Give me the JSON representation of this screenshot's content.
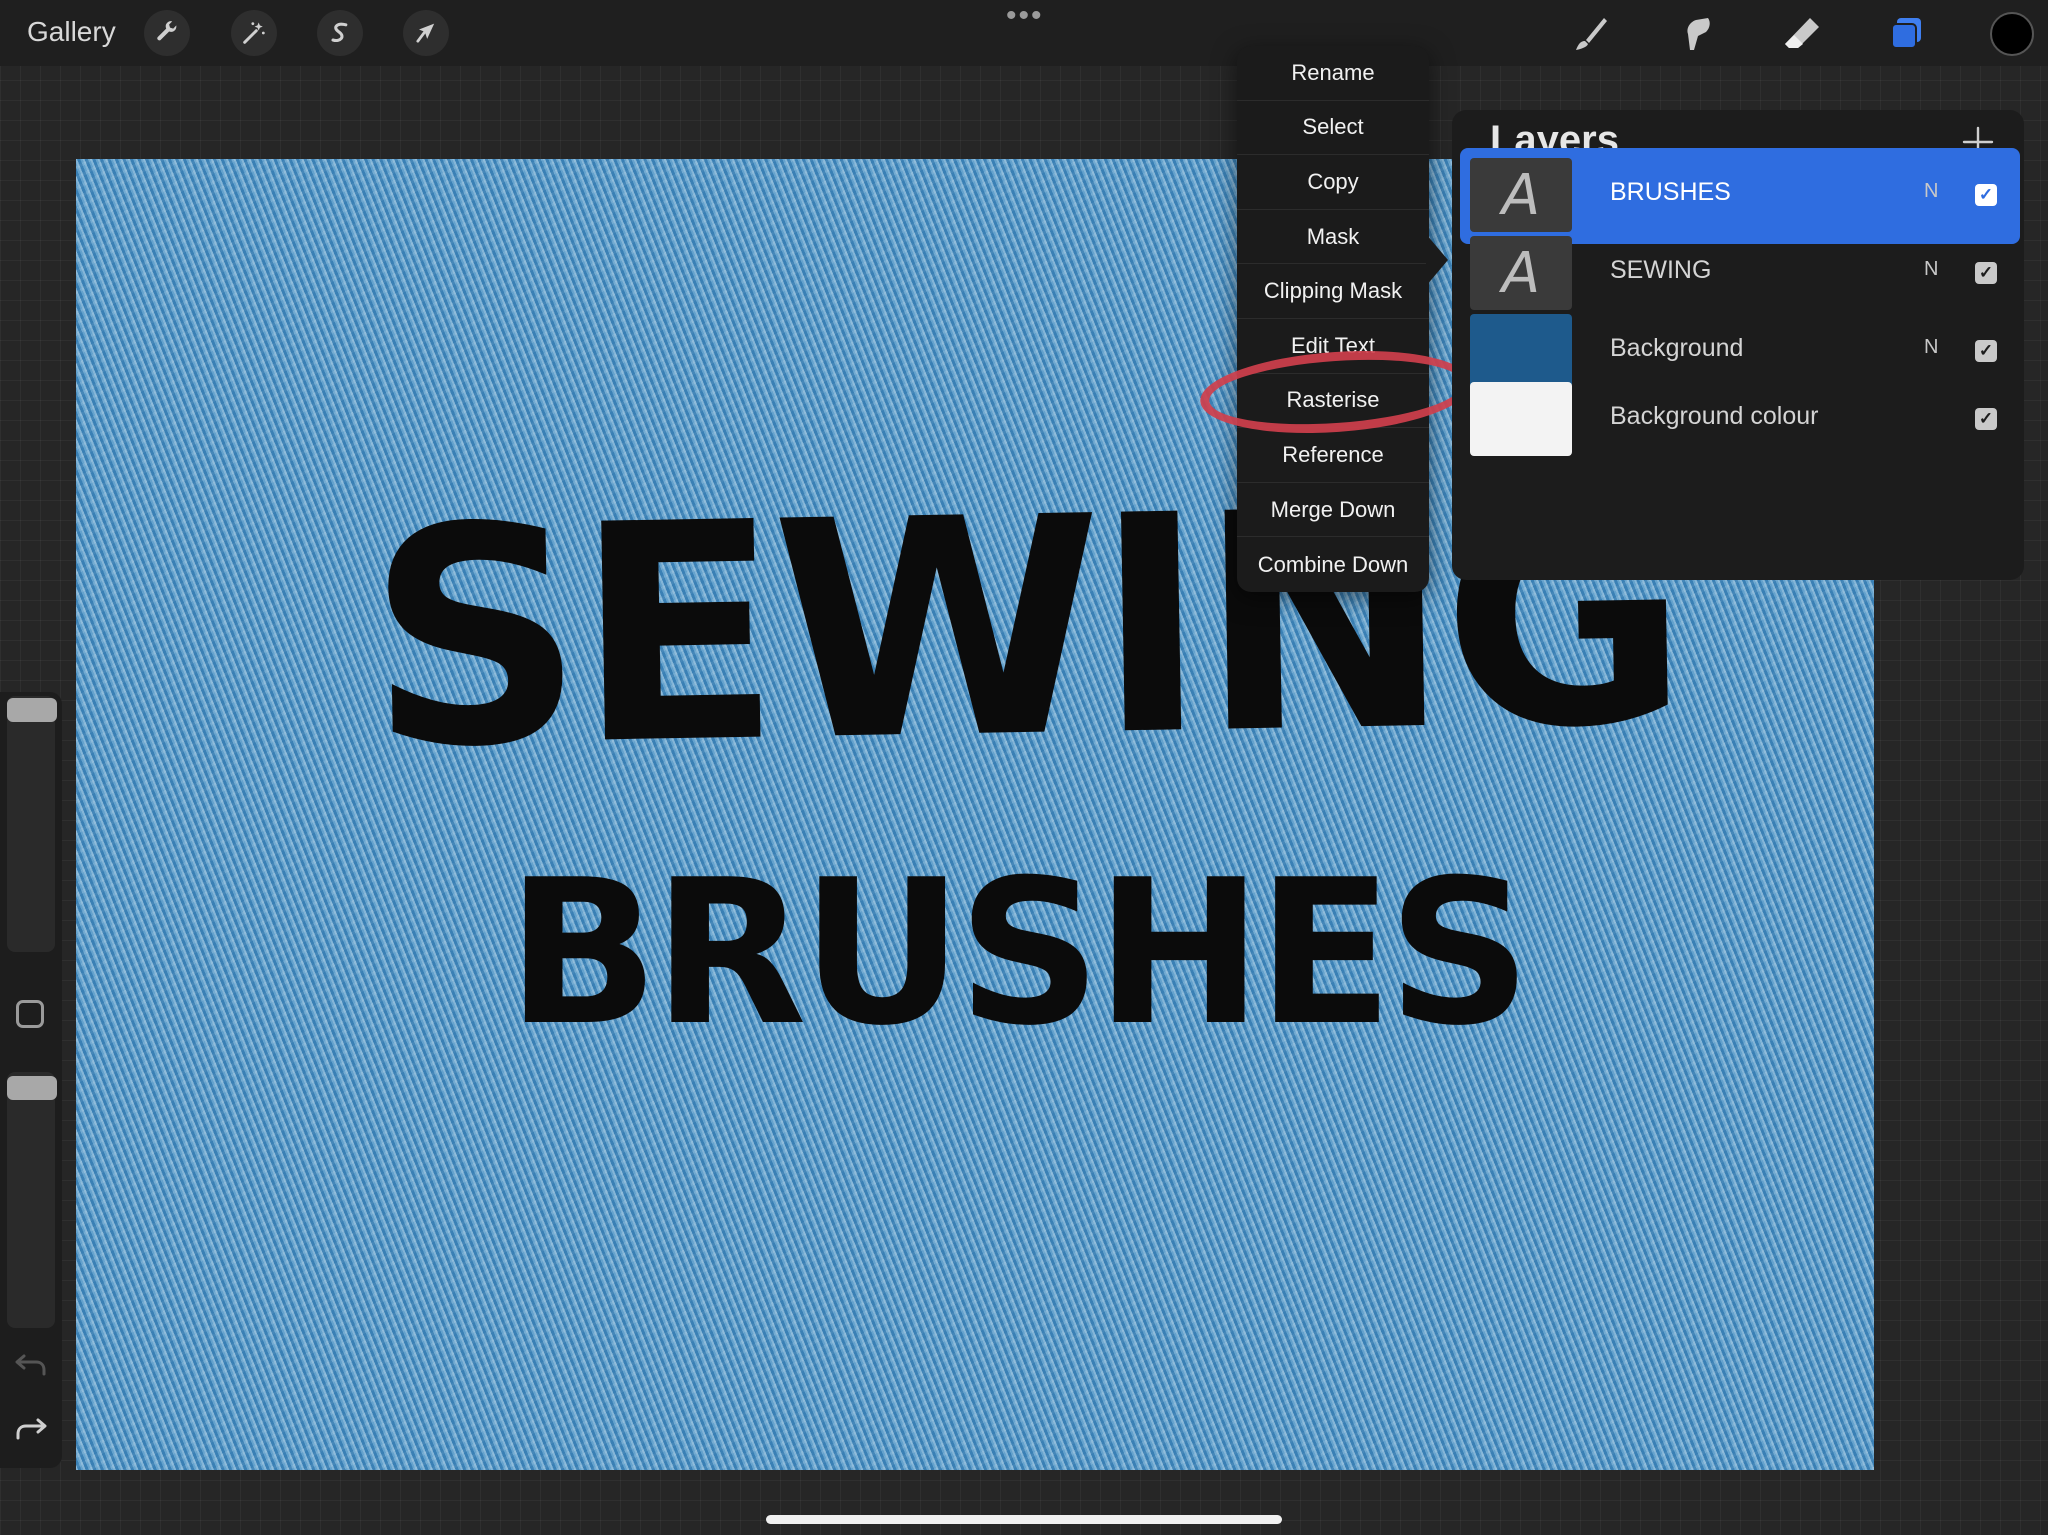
{
  "topbar": {
    "gallery_label": "Gallery",
    "left_tools": [
      "wrench-icon",
      "magic-wand-icon",
      "selection-s-icon",
      "transform-arrow-icon"
    ],
    "more_label": "•••",
    "right_tools": [
      "brush-icon",
      "smudge-icon",
      "eraser-icon",
      "layers-icon"
    ],
    "active_color": "#000000"
  },
  "canvas": {
    "art_line1": "SEWING",
    "art_line2": "BRUSHES",
    "texture": "denim",
    "base_color": "#4f95c6"
  },
  "context_menu": {
    "items": [
      "Rename",
      "Select",
      "Copy",
      "Mask",
      "Clipping Mask",
      "Edit Text",
      "Rasterise",
      "Reference",
      "Merge Down",
      "Combine Down"
    ],
    "highlighted_item": "Rasterise",
    "highlight_color": "#cf3f4c"
  },
  "layers_panel": {
    "title": "Layers",
    "add_label": "+",
    "rows": [
      {
        "name": "BRUSHES",
        "mode": "N",
        "thumb": "A",
        "visible": true,
        "active": true
      },
      {
        "name": "SEWING",
        "mode": "N",
        "thumb": "A",
        "visible": true,
        "active": false
      },
      {
        "name": "Background",
        "mode": "N",
        "thumb": "",
        "visible": true,
        "active": false
      },
      {
        "name": "Background colour",
        "mode": "",
        "thumb": "",
        "visible": true,
        "active": false
      }
    ],
    "accent": "#2f6de0"
  }
}
